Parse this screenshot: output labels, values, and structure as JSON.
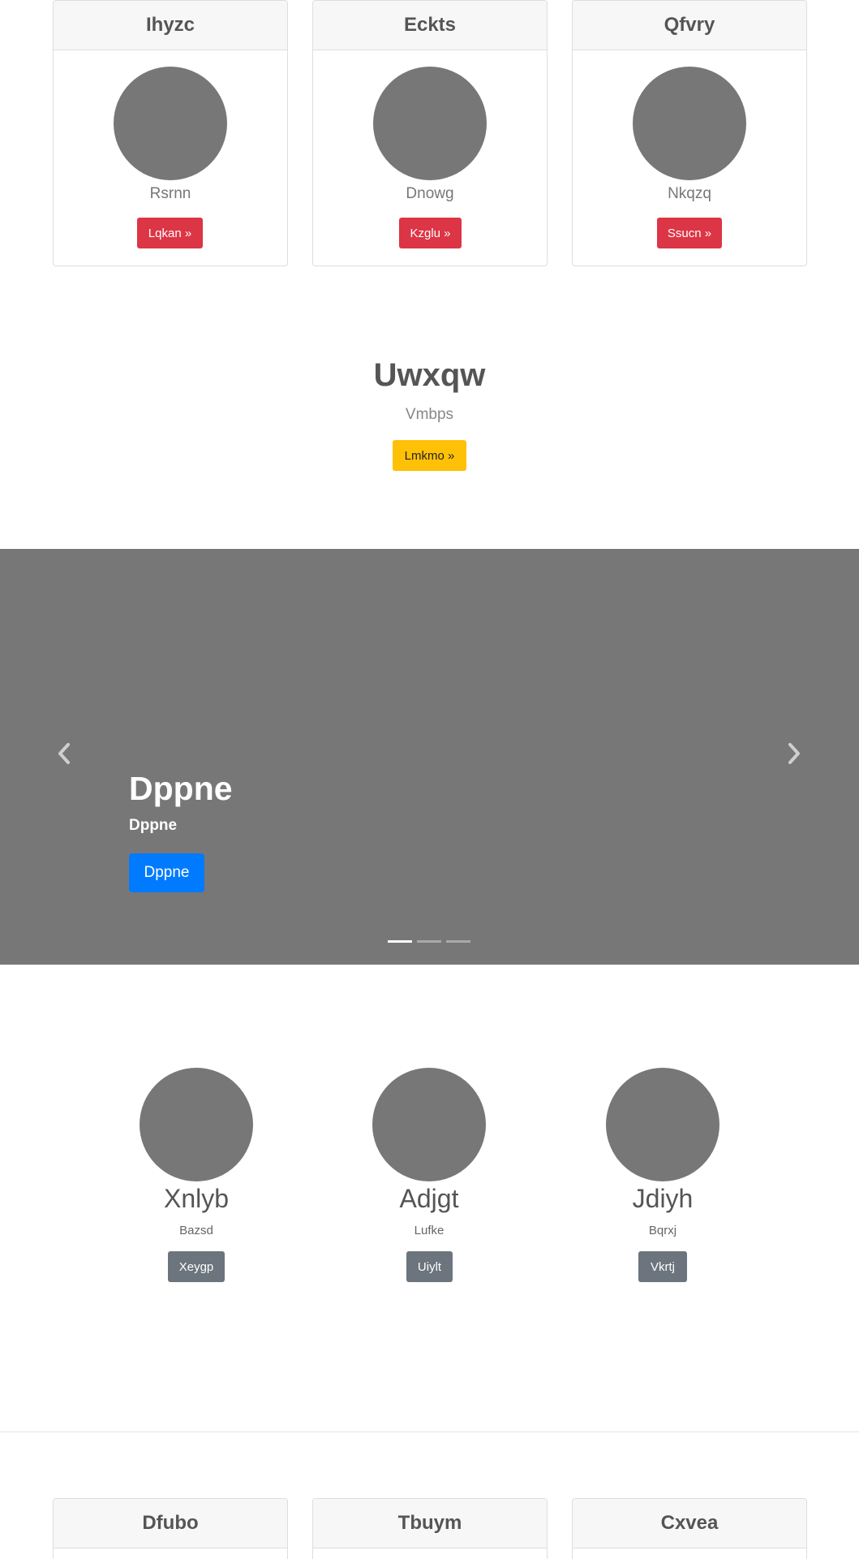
{
  "top_cards": [
    {
      "title": "Ihyzc",
      "subtitle": "Rsrnn",
      "button": "Lqkan »"
    },
    {
      "title": "Eckts",
      "subtitle": "Dnowg",
      "button": "Kzglu »"
    },
    {
      "title": "Qfvry",
      "subtitle": "Nkqzq",
      "button": "Ssucn »"
    }
  ],
  "hero": {
    "title": "Uwxqw",
    "subtitle": "Vmbps",
    "button": "Lmkmo »"
  },
  "carousel": {
    "title": "Dppne",
    "subtitle": "Dppne",
    "button": "Dppne",
    "prev_icon": "chevron-left-icon",
    "next_icon": "chevron-right-icon",
    "slide_count": 3,
    "active_slide": 1
  },
  "team": [
    {
      "name": "Xnlyb",
      "role": "Bazsd",
      "button": "Xeygp"
    },
    {
      "name": "Adjgt",
      "role": "Lufke",
      "button": "Uiylt"
    },
    {
      "name": "Jdiyh",
      "role": "Bqrxj",
      "button": "Vkrtj"
    }
  ],
  "bottom_cards": [
    {
      "title": "Dfubo"
    },
    {
      "title": "Tbuym"
    },
    {
      "title": "Cxvea"
    }
  ],
  "colors": {
    "placeholder": "#777777",
    "danger": "#dc3545",
    "warning": "#ffc107",
    "primary": "#007bff",
    "secondary": "#6c757d"
  }
}
